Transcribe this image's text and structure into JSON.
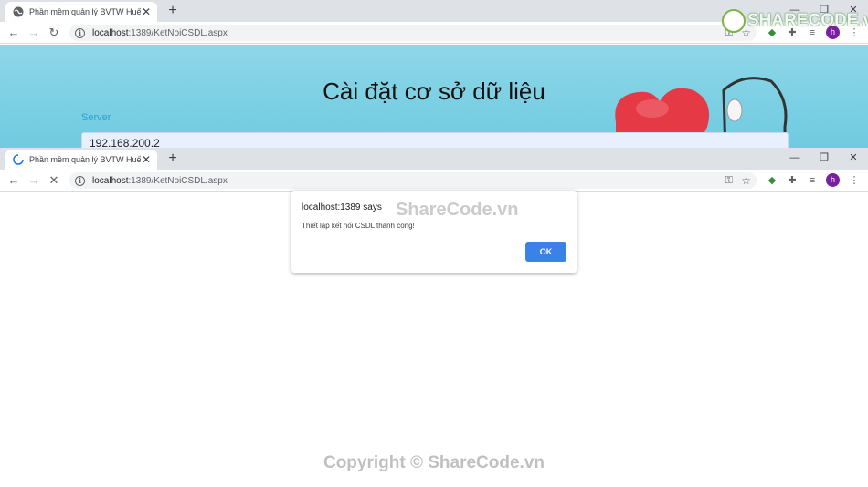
{
  "top_window": {
    "tab_title": "Phần mềm quản lý BVTW Huế",
    "url_host": "localhost",
    "url_rest": ":1389/KetNoiCSDL.aspx",
    "page_heading": "Cài đặt cơ sở dữ liệu",
    "server_label": "Server",
    "server_value": "192.168.200.2",
    "avatar_letter": "h"
  },
  "bottom_window": {
    "tab_title": "Phần mềm quản lý BVTW Huế",
    "url_host": "localhost",
    "url_rest": ":1389/KetNoiCSDL.aspx",
    "avatar_letter": "h"
  },
  "dialog": {
    "title": "localhost:1389 says",
    "message": "Thiết lập kết nối CSDL thành công!",
    "ok_label": "OK"
  },
  "watermarks": {
    "logo_text": "SHARECODE.vn",
    "dialog_text": "ShareCode.vn",
    "copyright": "Copyright © ShareCode.vn"
  },
  "colors": {
    "page_bg": "#7fd0e4",
    "accent": "#3b82e6",
    "avatar": "#7b1fa2"
  }
}
